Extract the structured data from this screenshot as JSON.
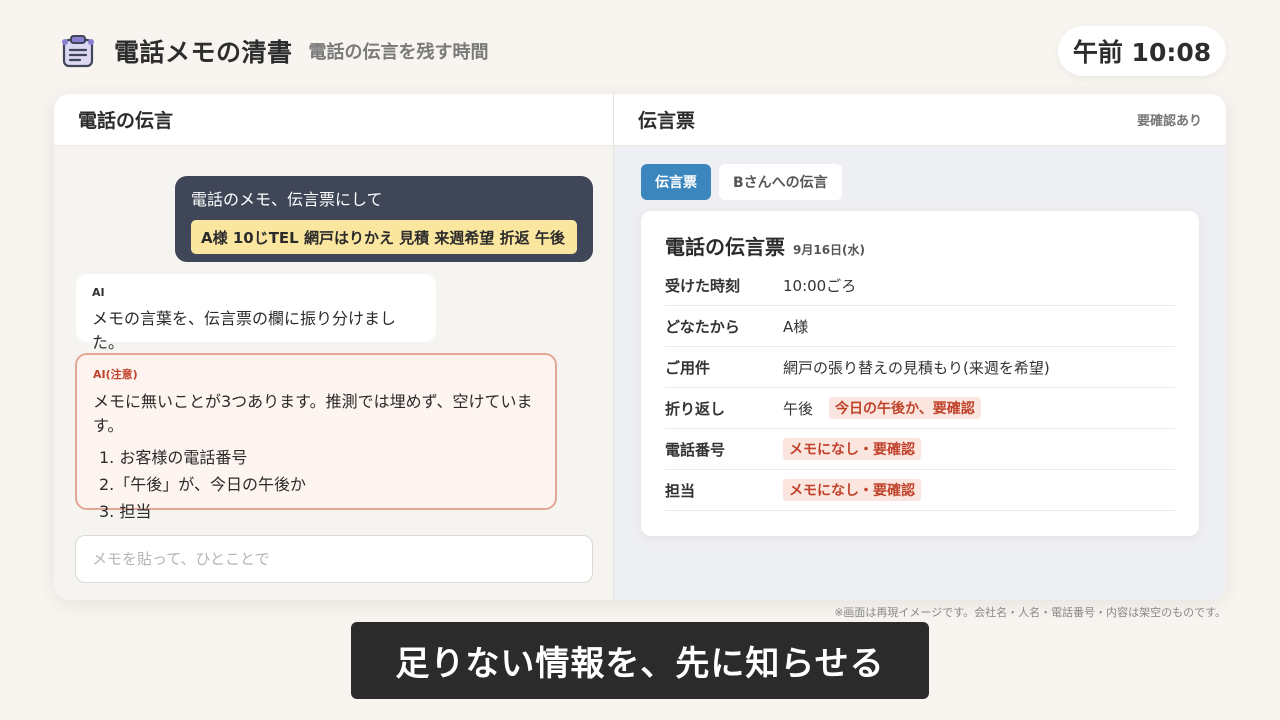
{
  "header": {
    "icon": "clipboard-icon",
    "title": "電話メモの清書",
    "subtitle": "電話の伝言を残す時間",
    "clock": "午前 10:08"
  },
  "left_pane": {
    "title": "電話の伝言",
    "user_message": {
      "text": "電話のメモ、伝言票にして",
      "memo": "A様 10じTEL 網戸はりかえ 見積 来週希望 折返 午後"
    },
    "ai_message": {
      "label": "AI",
      "text": "メモの言葉を、伝言票の欄に振り分けました。"
    },
    "ai_warning": {
      "label": "AI(注意)",
      "text": "メモに無いことが3つあります。推測では埋めず、空けています。",
      "items": [
        "1. お客様の電話番号",
        "2.「午後」が、今日の午後か",
        "3. 担当"
      ]
    },
    "input_placeholder": "メモを貼って、ひとことで"
  },
  "right_pane": {
    "title": "伝言票",
    "status": "要確認あり",
    "tabs": [
      {
        "label": "伝言票",
        "active": true
      },
      {
        "label": "Bさんへの伝言",
        "active": false
      }
    ],
    "slip": {
      "title": "電話の伝言票",
      "date": "9月16日(水)",
      "rows": [
        {
          "key": "受けた時刻",
          "value": "10:00ごろ",
          "flag": ""
        },
        {
          "key": "どなたから",
          "value": "A様",
          "flag": ""
        },
        {
          "key": "ご用件",
          "value": "網戸の張り替えの見積もり(来週を希望)",
          "flag": ""
        },
        {
          "key": "折り返し",
          "value": "午後",
          "flag": "今日の午後か、要確認"
        },
        {
          "key": "電話番号",
          "value": "",
          "flag": "メモになし・要確認"
        },
        {
          "key": "担当",
          "value": "",
          "flag": "メモになし・要確認"
        }
      ]
    }
  },
  "colors": {
    "accent": "#3a86bd",
    "warning": "#c0432c",
    "memo_highlight": "#fbe6a0",
    "user_bubble": "#3e4657"
  },
  "disclaimer": "※画面は再現イメージです。会社名・人名・電話番号・内容は架空のものです。",
  "caption": "足りない情報を、先に知らせる"
}
